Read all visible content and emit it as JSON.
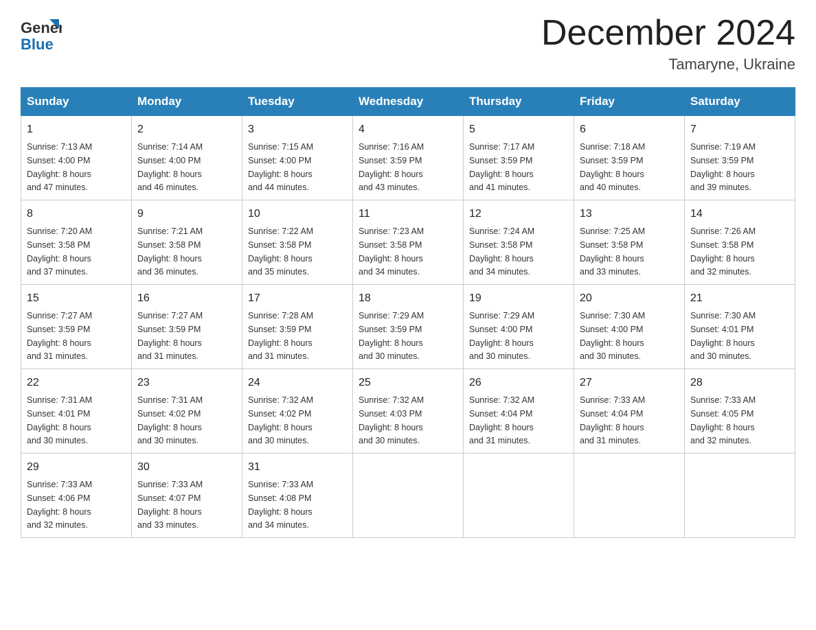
{
  "header": {
    "logo_general": "General",
    "logo_blue": "Blue",
    "month_title": "December 2024",
    "location": "Tamaryne, Ukraine"
  },
  "days_of_week": [
    "Sunday",
    "Monday",
    "Tuesday",
    "Wednesday",
    "Thursday",
    "Friday",
    "Saturday"
  ],
  "weeks": [
    [
      {
        "day": "1",
        "sunrise": "7:13 AM",
        "sunset": "4:00 PM",
        "daylight": "8 hours and 47 minutes."
      },
      {
        "day": "2",
        "sunrise": "7:14 AM",
        "sunset": "4:00 PM",
        "daylight": "8 hours and 46 minutes."
      },
      {
        "day": "3",
        "sunrise": "7:15 AM",
        "sunset": "4:00 PM",
        "daylight": "8 hours and 44 minutes."
      },
      {
        "day": "4",
        "sunrise": "7:16 AM",
        "sunset": "3:59 PM",
        "daylight": "8 hours and 43 minutes."
      },
      {
        "day": "5",
        "sunrise": "7:17 AM",
        "sunset": "3:59 PM",
        "daylight": "8 hours and 41 minutes."
      },
      {
        "day": "6",
        "sunrise": "7:18 AM",
        "sunset": "3:59 PM",
        "daylight": "8 hours and 40 minutes."
      },
      {
        "day": "7",
        "sunrise": "7:19 AM",
        "sunset": "3:59 PM",
        "daylight": "8 hours and 39 minutes."
      }
    ],
    [
      {
        "day": "8",
        "sunrise": "7:20 AM",
        "sunset": "3:58 PM",
        "daylight": "8 hours and 37 minutes."
      },
      {
        "day": "9",
        "sunrise": "7:21 AM",
        "sunset": "3:58 PM",
        "daylight": "8 hours and 36 minutes."
      },
      {
        "day": "10",
        "sunrise": "7:22 AM",
        "sunset": "3:58 PM",
        "daylight": "8 hours and 35 minutes."
      },
      {
        "day": "11",
        "sunrise": "7:23 AM",
        "sunset": "3:58 PM",
        "daylight": "8 hours and 34 minutes."
      },
      {
        "day": "12",
        "sunrise": "7:24 AM",
        "sunset": "3:58 PM",
        "daylight": "8 hours and 34 minutes."
      },
      {
        "day": "13",
        "sunrise": "7:25 AM",
        "sunset": "3:58 PM",
        "daylight": "8 hours and 33 minutes."
      },
      {
        "day": "14",
        "sunrise": "7:26 AM",
        "sunset": "3:58 PM",
        "daylight": "8 hours and 32 minutes."
      }
    ],
    [
      {
        "day": "15",
        "sunrise": "7:27 AM",
        "sunset": "3:59 PM",
        "daylight": "8 hours and 31 minutes."
      },
      {
        "day": "16",
        "sunrise": "7:27 AM",
        "sunset": "3:59 PM",
        "daylight": "8 hours and 31 minutes."
      },
      {
        "day": "17",
        "sunrise": "7:28 AM",
        "sunset": "3:59 PM",
        "daylight": "8 hours and 31 minutes."
      },
      {
        "day": "18",
        "sunrise": "7:29 AM",
        "sunset": "3:59 PM",
        "daylight": "8 hours and 30 minutes."
      },
      {
        "day": "19",
        "sunrise": "7:29 AM",
        "sunset": "4:00 PM",
        "daylight": "8 hours and 30 minutes."
      },
      {
        "day": "20",
        "sunrise": "7:30 AM",
        "sunset": "4:00 PM",
        "daylight": "8 hours and 30 minutes."
      },
      {
        "day": "21",
        "sunrise": "7:30 AM",
        "sunset": "4:01 PM",
        "daylight": "8 hours and 30 minutes."
      }
    ],
    [
      {
        "day": "22",
        "sunrise": "7:31 AM",
        "sunset": "4:01 PM",
        "daylight": "8 hours and 30 minutes."
      },
      {
        "day": "23",
        "sunrise": "7:31 AM",
        "sunset": "4:02 PM",
        "daylight": "8 hours and 30 minutes."
      },
      {
        "day": "24",
        "sunrise": "7:32 AM",
        "sunset": "4:02 PM",
        "daylight": "8 hours and 30 minutes."
      },
      {
        "day": "25",
        "sunrise": "7:32 AM",
        "sunset": "4:03 PM",
        "daylight": "8 hours and 30 minutes."
      },
      {
        "day": "26",
        "sunrise": "7:32 AM",
        "sunset": "4:04 PM",
        "daylight": "8 hours and 31 minutes."
      },
      {
        "day": "27",
        "sunrise": "7:33 AM",
        "sunset": "4:04 PM",
        "daylight": "8 hours and 31 minutes."
      },
      {
        "day": "28",
        "sunrise": "7:33 AM",
        "sunset": "4:05 PM",
        "daylight": "8 hours and 32 minutes."
      }
    ],
    [
      {
        "day": "29",
        "sunrise": "7:33 AM",
        "sunset": "4:06 PM",
        "daylight": "8 hours and 32 minutes."
      },
      {
        "day": "30",
        "sunrise": "7:33 AM",
        "sunset": "4:07 PM",
        "daylight": "8 hours and 33 minutes."
      },
      {
        "day": "31",
        "sunrise": "7:33 AM",
        "sunset": "4:08 PM",
        "daylight": "8 hours and 34 minutes."
      },
      null,
      null,
      null,
      null
    ]
  ],
  "labels": {
    "sunrise": "Sunrise:",
    "sunset": "Sunset:",
    "daylight": "Daylight:"
  }
}
